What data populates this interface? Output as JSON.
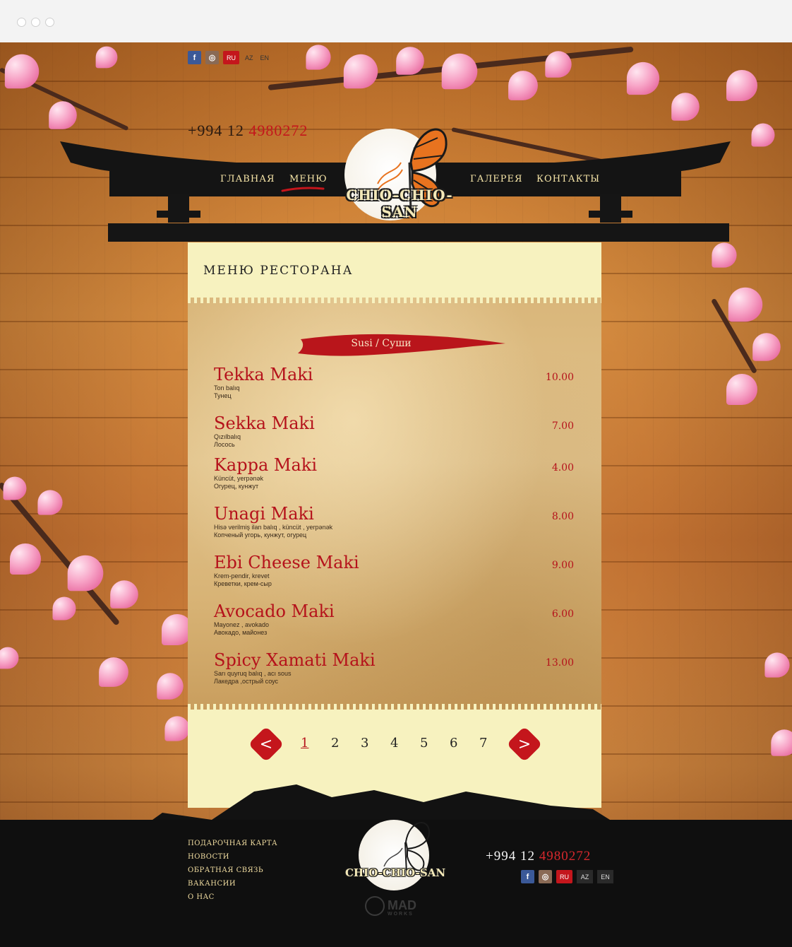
{
  "header": {
    "social": {
      "facebook": "f",
      "instagram": "◎"
    },
    "languages": [
      "RU",
      "AZ",
      "EN"
    ],
    "active_language": "RU",
    "phone_prefix": "+994 12 ",
    "phone_number": "4980272"
  },
  "nav": {
    "items": [
      "ГЛАВНАЯ",
      "МЕНЮ",
      "ГАЛЕРЕЯ",
      "КОНТАКТЫ"
    ],
    "active": "МЕНЮ"
  },
  "logo": {
    "text": "CHIO-CHIO-SAN"
  },
  "menu": {
    "title": "МЕНЮ РЕСТОРАНА",
    "category": "Susi / Суши",
    "items": [
      {
        "name": "Tekka Maki",
        "desc_az": "Ton balıq",
        "desc_ru": "Тунец",
        "price": "10.00"
      },
      {
        "name": "Sekka Maki",
        "desc_az": "Qızılbalıq",
        "desc_ru": "Лосось",
        "price": "7.00"
      },
      {
        "name": "Kappa Maki",
        "desc_az": "Küncüt, yerpənək",
        "desc_ru": "Огурец, кунжут",
        "price": "4.00"
      },
      {
        "name": "Unagi Maki",
        "desc_az": "Hisə verilmiş ilan balıq , küncüt , yerpənək",
        "desc_ru": "Копченый угорь, кунжут, огурец",
        "price": "8.00"
      },
      {
        "name": "Ebi Cheese Maki",
        "desc_az": "Krem-pendir, krevet",
        "desc_ru": "Креветки,  крем-сыр",
        "price": "9.00"
      },
      {
        "name": "Avocado Maki",
        "desc_az": "Mayonez , avokado",
        "desc_ru": "Авокадо, майонез",
        "price": "6.00"
      },
      {
        "name": "Spicy Xamati Maki",
        "desc_az": "Sarı quyruq balıq , acı sous",
        "desc_ru": "Лакедра ,острый соус",
        "price": "13.00"
      }
    ]
  },
  "pagination": {
    "prev": "<",
    "next": ">",
    "pages": [
      "1",
      "2",
      "3",
      "4",
      "5",
      "6",
      "7"
    ],
    "active": "1"
  },
  "footer": {
    "links": [
      "ПОДАРОЧНАЯ КАРТА",
      "НОВОСТИ",
      "ОБРАТНАЯ СВЯЗЬ",
      "ВАКАНСИИ",
      "О НАС"
    ],
    "logo_text": "CHIO-CHIO-SAN",
    "phone_prefix": "+994 12 ",
    "phone_number": "4980272",
    "languages": [
      "RU",
      "AZ",
      "EN"
    ],
    "developer": "MAD",
    "developer_sub": "WORKS"
  },
  "colors": {
    "accent": "#c4161c",
    "panel": "#f7f2bf",
    "footer": "#0f0f0f"
  }
}
